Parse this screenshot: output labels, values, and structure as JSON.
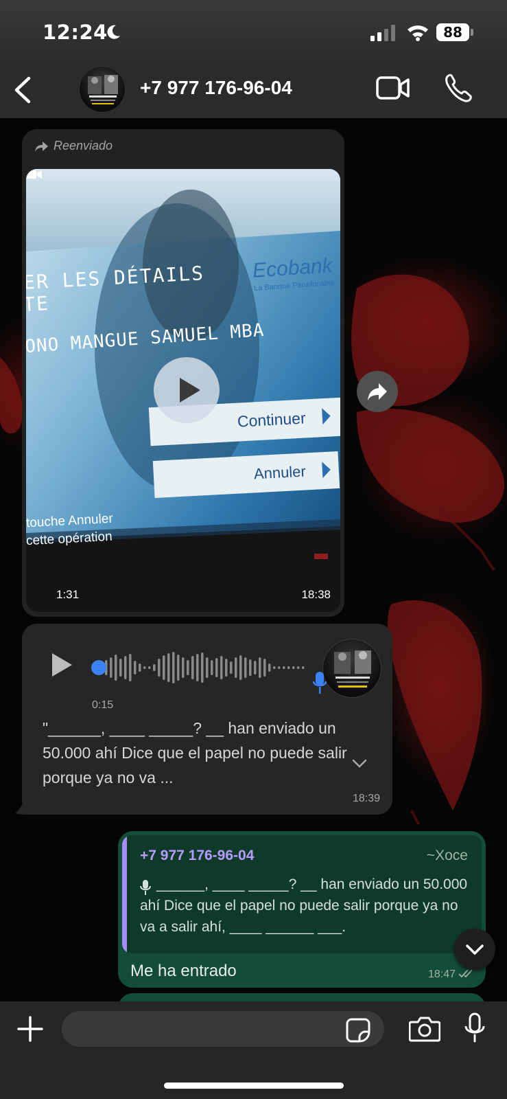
{
  "status_bar": {
    "time": "12:24",
    "battery": "88",
    "icons": [
      "moon-icon",
      "signal-icon",
      "wifi-icon",
      "battery-icon"
    ]
  },
  "header": {
    "contact_name": "+7 977 176-96-04",
    "icons": [
      "back-icon",
      "video-call-icon",
      "phone-icon"
    ]
  },
  "messages": {
    "video": {
      "forwarded_label": "Reenviado",
      "screen_text": {
        "line1": "ER LES DÉTAILS",
        "line2": "TE",
        "brand": "Ecobank",
        "brand_tagline": "La Banque Panafricaine",
        "name_line": "ONO MANGUE SAMUEL MBA",
        "continue_button": "Continuer",
        "cancel_button": "Annuler",
        "footer1": "touche Annuler",
        "footer2": "cette opération"
      },
      "duration": "1:31",
      "time": "18:38"
    },
    "voice": {
      "duration": "0:15",
      "progress": 0.0,
      "transcript": "\"______, ____ _____? __ han enviado un 50.000 ahí Dice que el papel no puede salir porque ya no va ...",
      "time": "18:39"
    },
    "reply": {
      "quoted_author": "+7 977 176-96-04",
      "quoted_alias": "~Xoce",
      "quoted_text": "______, ____ _____? __ han enviado un 50.000 ahí Dice que el papel no puede salir porque ya no va a salir ahí, ____ ______ ___.",
      "text": "Me ha entrado",
      "time": "18:47",
      "status": "read"
    }
  },
  "composer": {
    "placeholder": ""
  },
  "colors": {
    "outgoing_bubble": "#144d37",
    "incoming_bubble": "#262626",
    "quote_accent": "#a78bfa",
    "voice_accent": "#3b82f6"
  }
}
